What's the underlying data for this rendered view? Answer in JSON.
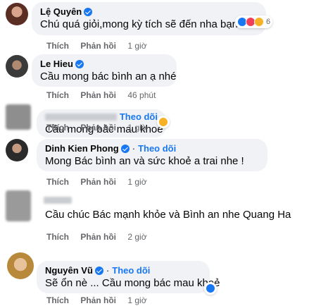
{
  "comments": [
    {
      "name": "Lệ Quyên",
      "verified": true,
      "text": "Chú quá giỏi,mong kỳ tích sẽ đến nha bạn iu",
      "like": "Thích",
      "reply": "Phản hồi",
      "time": "1 giờ",
      "reaction_count": "6"
    },
    {
      "name": "Le Hieu",
      "verified": true,
      "text": "Cầu mong bác bình an ạ nhé",
      "like": "Thích",
      "reply": "Phản hồi",
      "time": "46 phút"
    },
    {
      "name": "",
      "follow": "Theo dõi",
      "text": "Cầu mong bác mau khoẻ",
      "like": "Thích",
      "reply": "Phản hồi",
      "time": "1 giờ"
    },
    {
      "name": "Dinh Kien Phong",
      "verified": true,
      "follow": "Theo dõi",
      "text": "Mong Bác bình an và sức khoẻ a trai nhe !",
      "like": "Thích",
      "reply": "Phản hồi",
      "time": "1 giờ"
    },
    {
      "name": "",
      "text": "Cầu chúc Bác mạnh khỏe và Bình an nhe Quang Ha",
      "like": "Thích",
      "reply": "Phản hồi",
      "time": "2 giờ"
    },
    {
      "name": "Nguyên Vũ",
      "verified": true,
      "follow": "Theo dõi",
      "text": "Sẽ ổn nè ... Cầu mong bác mau khoẻ",
      "like": "Thích",
      "reply": "Phản hồi",
      "time": "1 giờ"
    }
  ],
  "separator": "·",
  "colors": {
    "link": "#1877f2",
    "bubble": "#f0f2f5",
    "meta": "#65676b"
  },
  "icons": [
    "verified-badge-icon",
    "like-reaction-icon",
    "love-reaction-icon",
    "care-reaction-icon",
    "haha-reaction-icon"
  ]
}
